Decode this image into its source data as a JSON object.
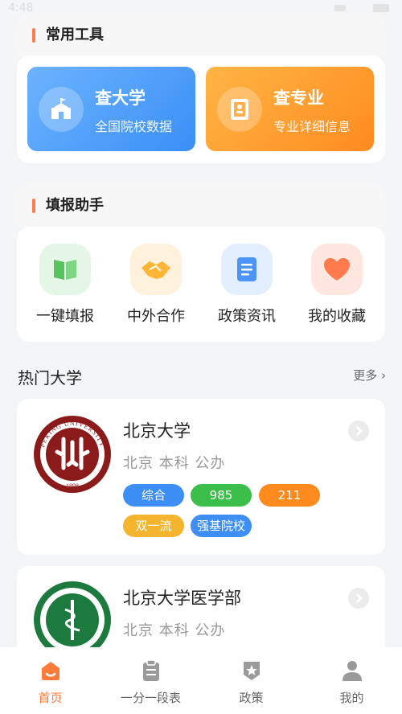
{
  "status_bar": {
    "time": "4:48"
  },
  "tools": {
    "title": "常用工具",
    "items": [
      {
        "title": "查大学",
        "subtitle": "全国院校数据",
        "icon": "school-icon"
      },
      {
        "title": "查专业",
        "subtitle": "专业详细信息",
        "icon": "book-icon"
      }
    ]
  },
  "assistant": {
    "title": "填报助手",
    "items": [
      {
        "label": "一键填报",
        "icon": "book-open-icon"
      },
      {
        "label": "中外合作",
        "icon": "handshake-icon"
      },
      {
        "label": "政策资讯",
        "icon": "document-icon"
      },
      {
        "label": "我的收藏",
        "icon": "heart-icon"
      }
    ]
  },
  "hot": {
    "title": "热门大学",
    "more": "更多 ›",
    "universities": [
      {
        "name": "北京大学",
        "meta": "北京  本科  公办",
        "logo_text": "PEKING UNIVERSITY",
        "logo_year": "1898",
        "tags": [
          {
            "label": "综合",
            "color": "#3d8ef5"
          },
          {
            "label": "985",
            "color": "#3cbf4a"
          },
          {
            "label": "211",
            "color": "#ff8a1e"
          },
          {
            "label": "双一流",
            "color": "#f5b42d"
          },
          {
            "label": "强基院校",
            "color": "#3d8ef5"
          }
        ]
      },
      {
        "name": "北京大学医学部",
        "meta": "北京  本科  公办",
        "logo_year": "1912"
      }
    ]
  },
  "tabbar": {
    "items": [
      {
        "label": "首页",
        "icon": "home-icon",
        "active": true
      },
      {
        "label": "一分一段表",
        "icon": "clipboard-icon",
        "active": false
      },
      {
        "label": "政策",
        "icon": "badge-star-icon",
        "active": false
      },
      {
        "label": "我的",
        "icon": "user-icon",
        "active": false
      }
    ]
  },
  "colors": {
    "accent": "#ff7b3a",
    "blue": "#3a8ff5",
    "orange": "#ff8b1f"
  }
}
